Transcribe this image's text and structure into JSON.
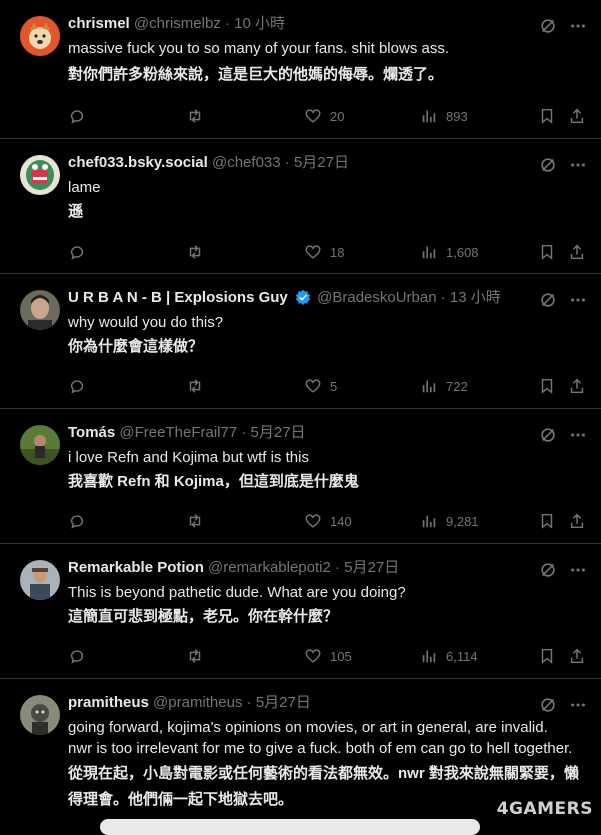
{
  "watermark": "4GAMERS",
  "posts": [
    {
      "name": "chrismel",
      "handle": "@chrismelbz",
      "time": "10 小時",
      "text_en": [
        "massive fuck you to so many of your fans. shit blows ass."
      ],
      "text_zh": [
        "對你們許多粉絲來說，這是巨大的他媽的侮辱。爛透了。"
      ],
      "replies": "",
      "retweets": "",
      "likes": "20",
      "views": "893",
      "verified": false
    },
    {
      "name": "chef033.bsky.social",
      "handle": "@chef033",
      "time": "5月27日",
      "text_en": [
        "lame"
      ],
      "text_zh": [
        "遜"
      ],
      "replies": "",
      "retweets": "",
      "likes": "18",
      "views": "1,608",
      "verified": false
    },
    {
      "name": "U R B A N - B | Explosions Guy",
      "handle": "@BradeskoUrban",
      "time": "13 小時",
      "text_en": [
        "why would you do this?"
      ],
      "text_zh": [
        "你為什麼會這樣做？"
      ],
      "replies": "",
      "retweets": "",
      "likes": "5",
      "views": "722",
      "verified": true
    },
    {
      "name": "Tomás",
      "handle": "@FreeTheFrail77",
      "time": "5月27日",
      "text_en": [
        "i love Refn and Kojima but wtf is this"
      ],
      "text_zh": [
        "我喜歡 Refn 和 Kojima，但這到底是什麼鬼"
      ],
      "replies": "",
      "retweets": "",
      "likes": "140",
      "views": "9,281",
      "verified": false
    },
    {
      "name": "Remarkable Potion",
      "handle": "@remarkablepoti2",
      "time": "5月27日",
      "text_en": [
        "This is beyond pathetic dude. What are you doing?"
      ],
      "text_zh": [
        "這簡直可悲到極點，老兄。你在幹什麼？"
      ],
      "replies": "",
      "retweets": "",
      "likes": "105",
      "views": "6,114",
      "verified": false
    },
    {
      "name": "pramitheus",
      "handle": "@pramitheus",
      "time": "5月27日",
      "text_en": [
        "going forward, kojima's opinions on movies, or art in general, are invalid.",
        "nwr is too irrelevant for me to give a fuck. both of em can go to hell together."
      ],
      "text_zh": [
        "從現在起，小島對電影或任何藝術的看法都無效。nwr 對我來說無關緊要，懶",
        "得理會。他們倆一起下地獄去吧。"
      ],
      "replies": "",
      "retweets": "",
      "likes": "",
      "views": "",
      "verified": false
    }
  ]
}
